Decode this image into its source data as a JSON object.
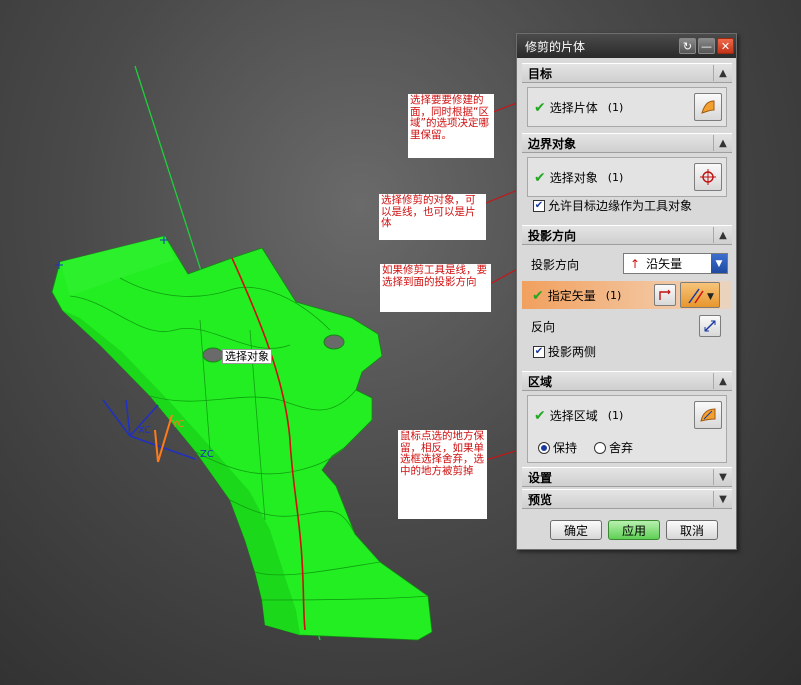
{
  "viewport": {
    "label_select_object": "选择对象",
    "axis": {
      "xc": "XC",
      "yc": "YC",
      "zc": "ZC"
    }
  },
  "annotations": [
    "选择要要修建的面，同时根据“区域”的选项决定哪里保留。",
    "选择修剪的对象，可以是线，也可以是片体",
    "如果修剪工具是线，要选择到面的投影方向",
    "鼠标点选的地方保留，相反，如果单选框选择舍弃，选中的地方被剪掉"
  ],
  "dialog": {
    "title": "修剪的片体",
    "sections": {
      "target": {
        "title": "目标",
        "select_label": "选择片体",
        "count": "(1)"
      },
      "boundary": {
        "title": "边界对象",
        "select_label": "选择对象",
        "count": "(1)",
        "allow_label": "允许目标边缘作为工具对象",
        "allow_checked": true
      },
      "projection": {
        "title": "投影方向",
        "dir_label": "投影方向",
        "dir_value": "沿矢量",
        "vector_label": "指定矢量",
        "count": "(1)",
        "reverse_label": "反向",
        "both_sides_label": "投影两侧",
        "both_sides_checked": true
      },
      "region": {
        "title": "区域",
        "select_label": "选择区域",
        "count": "(1)",
        "keep_label": "保持",
        "discard_label": "舍弃",
        "selected": "保持"
      },
      "settings": {
        "title": "设置"
      },
      "preview": {
        "title": "预览"
      }
    },
    "buttons": {
      "ok": "确定",
      "apply": "应用",
      "cancel": "取消"
    }
  },
  "colors": {
    "part": "#22ee22",
    "annotation_text": "#d01010",
    "leader": "#d01010",
    "accent": "#23a823"
  }
}
